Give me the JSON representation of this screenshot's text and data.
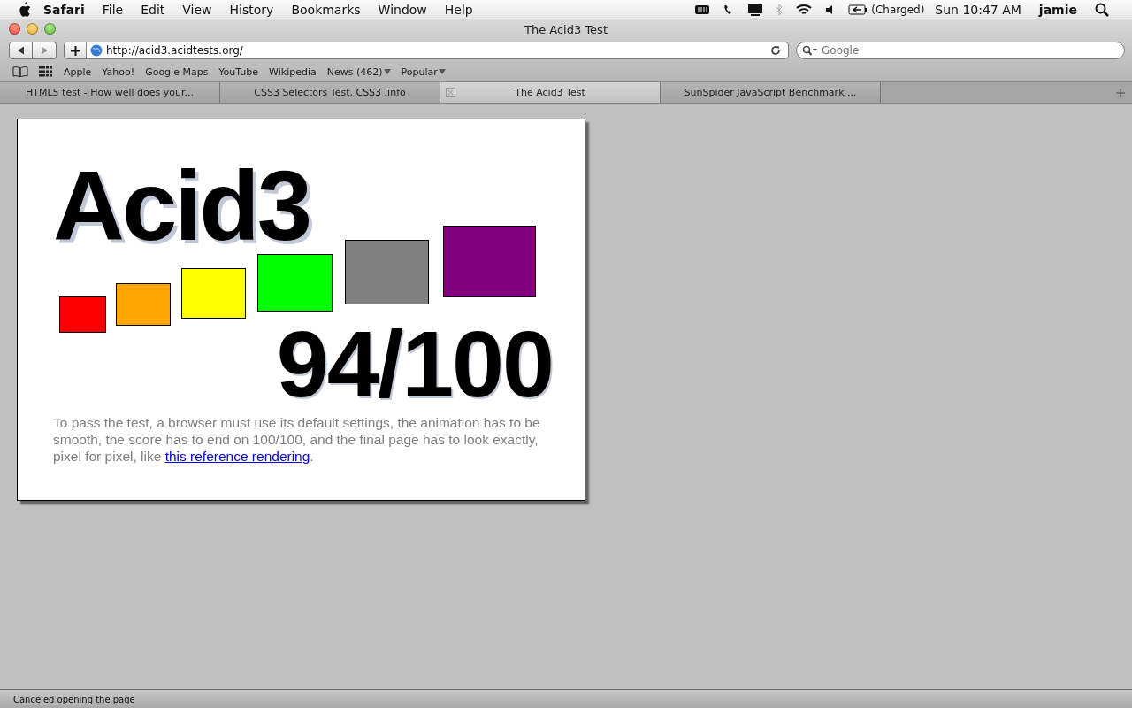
{
  "menu_bar": {
    "app": "Safari",
    "items": [
      "File",
      "Edit",
      "View",
      "History",
      "Bookmarks",
      "Window",
      "Help"
    ],
    "battery_status": "(Charged)",
    "clock": "Sun 10:47 AM",
    "user": "jamie"
  },
  "window": {
    "title": "The Acid3 Test"
  },
  "toolbar": {
    "address": "http://acid3.acidtests.org/",
    "search": {
      "placeholder": "Google"
    }
  },
  "bookmarks": [
    {
      "label": "Apple",
      "menu": false
    },
    {
      "label": "Yahoo!",
      "menu": false
    },
    {
      "label": "Google Maps",
      "menu": false
    },
    {
      "label": "YouTube",
      "menu": false
    },
    {
      "label": "Wikipedia",
      "menu": false
    },
    {
      "label": "News (462)",
      "menu": true
    },
    {
      "label": "Popular",
      "menu": true
    }
  ],
  "tabs": [
    {
      "label": "HTML5 test - How well does your...",
      "selected": false
    },
    {
      "label": "CSS3 Selectors Test, CSS3 .info",
      "selected": false
    },
    {
      "label": "The Acid3 Test",
      "selected": true
    },
    {
      "label": "SunSpider JavaScript Benchmark ...",
      "selected": false
    }
  ],
  "page": {
    "heading": "Acid3",
    "squares": [
      {
        "color": "#ff0000"
      },
      {
        "color": "#ffa500"
      },
      {
        "color": "#ffff00"
      },
      {
        "color": "#00ff00"
      },
      {
        "color": "#808080"
      },
      {
        "color": "#800080"
      }
    ],
    "score": "94/100",
    "text": "To pass the test, a browser must use its default settings, the animation has to be smooth, the score has to end on 100/100, and the final page has to look exactly, pixel for pixel, like ",
    "link": "this reference rendering",
    "text_end": "."
  },
  "status_bar": "Canceled opening the page"
}
